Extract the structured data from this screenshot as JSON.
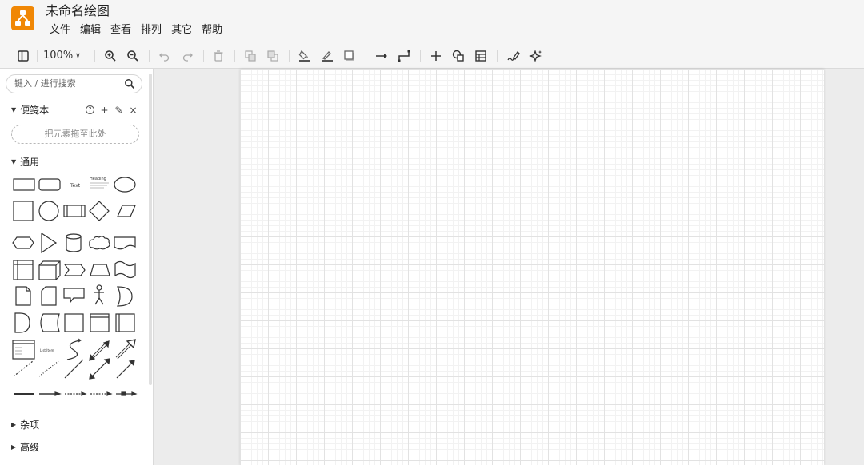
{
  "app": {
    "title": "未命名绘图",
    "logo_color": "#f08705"
  },
  "menu": {
    "items": [
      "文件",
      "编辑",
      "查看",
      "排列",
      "其它",
      "帮助"
    ]
  },
  "toolbar": {
    "zoom_label": "100%",
    "icons": [
      "sidebar-toggle-icon",
      "zoom-in-icon",
      "zoom-out-icon",
      "undo-icon",
      "redo-icon",
      "delete-icon",
      "to-front-icon",
      "to-back-icon",
      "fill-color-icon",
      "line-color-icon",
      "shadow-icon",
      "connection-icon",
      "waypoints-icon",
      "insert-icon",
      "shapes-icon",
      "table-icon",
      "freehand-icon",
      "ai-sparkle-icon"
    ]
  },
  "sidebar": {
    "search_placeholder": "键入 / 进行搜索",
    "scratchpad": {
      "label": "便笺本",
      "help": "?",
      "add": "+",
      "edit": "✎",
      "close": "×",
      "dropzone": "把元素拖至此处"
    },
    "general": {
      "label": "通用",
      "shape_text": "Text",
      "shape_heading": "Heading",
      "shape_list": "List Item"
    },
    "misc": {
      "label": "杂项"
    },
    "advanced": {
      "label": "高级"
    }
  }
}
